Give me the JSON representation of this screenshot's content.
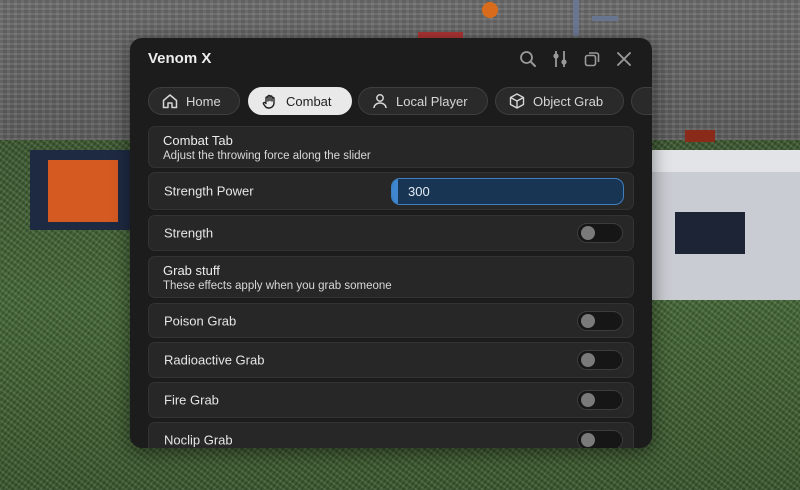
{
  "window": {
    "title": "Venom X",
    "title_icons": [
      "search-icon",
      "sliders-icon",
      "minimize-icon",
      "close-icon"
    ]
  },
  "tabs": [
    {
      "label": "Home",
      "icon": "home-icon",
      "active": false
    },
    {
      "label": "Combat",
      "icon": "hand-icon",
      "active": true
    },
    {
      "label": "Local Player",
      "icon": "user-icon",
      "active": false
    },
    {
      "label": "Object Grab",
      "icon": "cube-icon",
      "active": false
    }
  ],
  "combat": {
    "section1_title": "Combat Tab",
    "section1_desc": "Adjust the throwing force along the slider",
    "strength_power_label": "Strength Power",
    "strength_power_value": "300",
    "strength_power_fill": 0.02,
    "strength_label": "Strength",
    "strength_on": false,
    "section2_title": "Grab stuff",
    "section2_desc": "These effects apply when you grab someone",
    "toggles": [
      {
        "label": "Poison Grab",
        "on": false
      },
      {
        "label": "Radioactive Grab",
        "on": false
      },
      {
        "label": "Fire Grab",
        "on": false
      },
      {
        "label": "Noclip Grab",
        "on": false
      }
    ]
  },
  "colors": {
    "accent": "#3f86d0",
    "panel": "#1c1c1c",
    "card": "#272727"
  }
}
